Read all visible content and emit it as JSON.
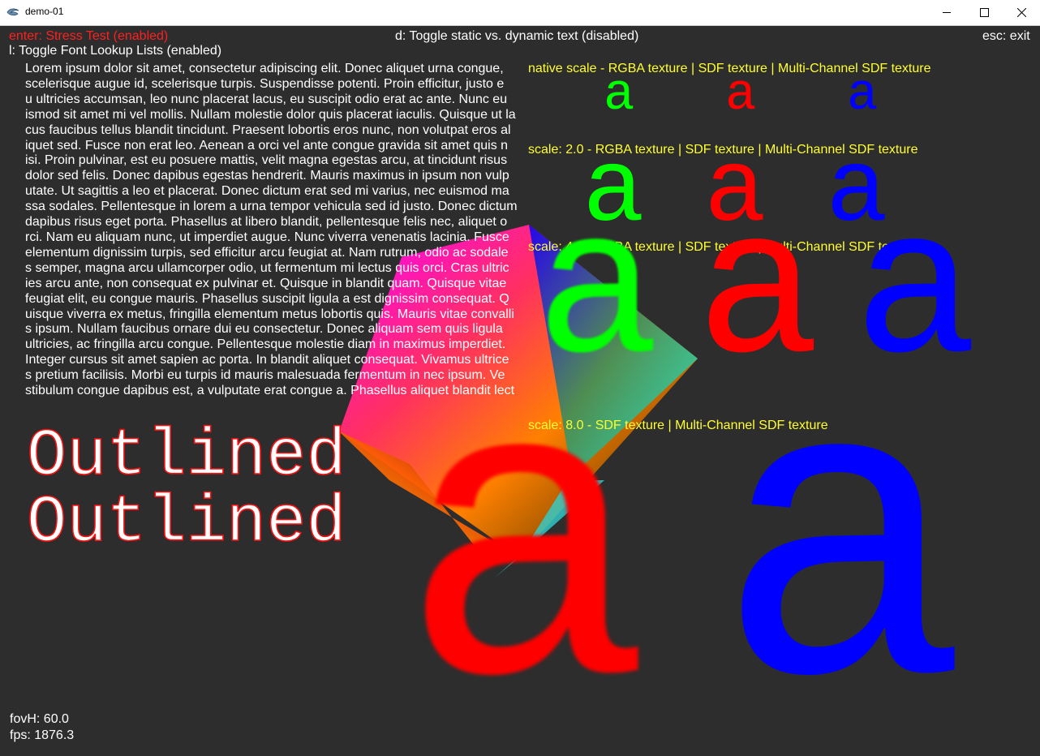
{
  "window": {
    "title": "demo-01",
    "icons": {
      "app": "app-icon",
      "minimize": "minimize-icon",
      "maximize": "maximize-icon",
      "close": "close-icon"
    }
  },
  "hud": {
    "stress_test": "enter: Stress Test (enabled)",
    "toggle_static": "d: Toggle static vs. dynamic text (disabled)",
    "exit": "esc: exit",
    "toggle_lookup": "l: Toggle Font Lookup Lists (enabled)"
  },
  "lorem_lines": [
    "Lorem ipsum dolor sit amet, consectetur adipiscing elit. Donec aliquet urna congue,",
    "scelerisque augue id, scelerisque turpis. Suspendisse potenti. Proin efficitur, justo e",
    "u ultricies accumsan, leo nunc placerat lacus, eu suscipit odio erat ac ante. Nunc eu",
    "ismod sit amet mi vel mollis. Nullam molestie dolor quis placerat iaculis. Quisque ut la",
    "cus faucibus tellus blandit tincidunt. Praesent lobortis eros nunc, non volutpat eros al",
    "iquet sed. Fusce non erat leo. Aenean a orci vel ante congue gravida sit amet quis n",
    "isi. Proin pulvinar, est eu posuere mattis, velit magna egestas arcu, at tincidunt risus",
    " dolor sed felis. Donec dapibus egestas hendrerit. Mauris maximus in ipsum non vulp",
    "utate. Ut sagittis a leo et placerat. Donec dictum erat sed mi varius, nec euismod ma",
    "ssa sodales. Pellentesque in lorem a urna tempor vehicula sed id justo. Donec dictum",
    " dapibus risus eget porta. Phasellus at libero blandit, pellentesque felis nec, aliquet o",
    "rci. Nam eu aliquam nunc, ut imperdiet augue. Nunc viverra venenatis lacinia. Fusce",
    " elementum dignissim turpis, sed efficitur arcu feugiat at. Nam rutrum, odio ac sodale",
    "s semper, magna arcu ullamcorper odio, ut fermentum mi lectus quis orci. Cras ultric",
    "ies arcu ante, non consequat ex pulvinar et. Quisque in blandit quam. Quisque vitae",
    "feugiat elit, eu congue mauris. Phasellus suscipit ligula a est dignissim consequat. Q",
    "uisque viverra ex metus, fringilla elementum metus lobortis quis. Mauris vitae convalli",
    "s ipsum. Nullam faucibus ornare dui eu consectetur. Donec aliquam sem quis ligula",
    "ultricies, ac fringilla arcu congue. Pellentesque molestie diam in maximus imperdiet.",
    "Integer cursus sit amet sapien ac porta. In blandit aliquet consequat. Vivamus ultrice",
    "s pretium facilisis. Morbi eu turpis id mauris malesuada fermentum in nec ipsum. Ve",
    "stibulum congue dapibus est, a vulputate erat congue a. Phasellus aliquet blandit lect"
  ],
  "scales": {
    "native": "native scale  - RGBA texture | SDF texture | Multi-Channel SDF texture",
    "s2": "scale: 2.0    - RGBA texture | SDF texture | Multi-Channel SDF texture",
    "s4": "scale: 4.0    - RGBA texture | SDF texture | Multi-Channel SDF texture",
    "s8": "scale: 8.0    -      SDF texture        |         Multi-Channel SDF texture"
  },
  "glyph_char": "a",
  "glyph_colors": {
    "rgba": "#00ff00",
    "sdf": "#ff0000",
    "msdf": "#0000ff"
  },
  "outlined": [
    "Outlined",
    "Outlined"
  ],
  "stats": {
    "fov": "fovH: 60.0",
    "fps": "fps: 1876.3"
  }
}
